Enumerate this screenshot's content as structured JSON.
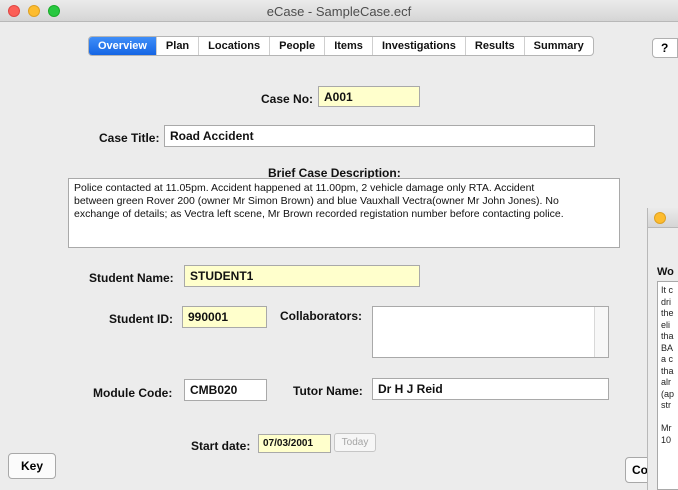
{
  "window": {
    "title": "eCase - SampleCase.ecf"
  },
  "tabs": [
    "Overview",
    "Plan",
    "Locations",
    "People",
    "Items",
    "Investigations",
    "Results",
    "Summary"
  ],
  "help_label": "?",
  "case_no": {
    "label": "Case No:",
    "value": "A001"
  },
  "case_title": {
    "label": "Case Title:",
    "value": "Road Accident"
  },
  "description": {
    "label": "Brief Case Description:",
    "lines": [
      "Police contacted at 11.05pm.  Accident happened at 11.00pm, 2 vehicle damage only RTA.  Accident",
      "between green Rover 200 (owner Mr Simon Brown) and blue Vauxhall Vectra(owner Mr John Jones).  No",
      "exchange of details; as Vectra left scene, Mr Brown recorded registation number before contacting police."
    ]
  },
  "student_name": {
    "label": "Student Name:",
    "value": "STUDENT1"
  },
  "student_id": {
    "label": "Student ID:",
    "value": "990001"
  },
  "collaborators": {
    "label": "Collaborators:",
    "value": ""
  },
  "module_code": {
    "label": "Module Code:",
    "value": "CMB020"
  },
  "tutor_name": {
    "label": "Tutor Name:",
    "value": "Dr H J Reid"
  },
  "start_date": {
    "label": "Start date:",
    "value": "07/03/2001",
    "today_label": "Today"
  },
  "buttons": {
    "key": "Key",
    "co": "Co"
  },
  "side_window": {
    "heading": "Wo",
    "lines": [
      "It c",
      "dri",
      "the",
      "eli",
      "tha",
      "BA",
      "a c",
      "tha",
      "alr",
      "(ap",
      "str",
      "",
      "Mr",
      "10"
    ]
  }
}
